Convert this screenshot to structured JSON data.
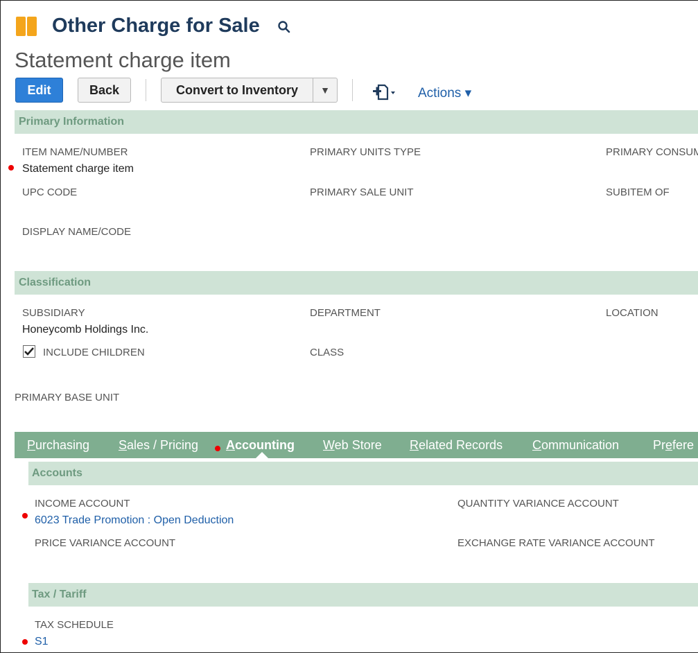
{
  "header": {
    "record_type": "Other Charge for Sale",
    "record_title": "Statement charge item"
  },
  "toolbar": {
    "edit_label": "Edit",
    "back_label": "Back",
    "convert_label": "Convert to Inventory",
    "convert_caret": "▼",
    "actions_label": "Actions ▾"
  },
  "primary_info": {
    "section_title": "Primary Information",
    "item_name_label": "ITEM NAME/NUMBER",
    "item_name_value": "Statement charge item",
    "primary_units_type_label": "PRIMARY UNITS TYPE",
    "primary_consum_label": "PRIMARY CONSUM",
    "upc_code_label": "UPC CODE",
    "primary_sale_unit_label": "PRIMARY SALE UNIT",
    "subitem_of_label": "SUBITEM OF",
    "display_name_label": "DISPLAY NAME/CODE"
  },
  "classification": {
    "section_title": "Classification",
    "subsidiary_label": "SUBSIDIARY",
    "subsidiary_value": "Honeycomb Holdings Inc.",
    "department_label": "DEPARTMENT",
    "location_label": "LOCATION",
    "include_children_label": "INCLUDE CHILDREN",
    "include_children_checked": true,
    "class_label": "CLASS",
    "primary_base_unit_label": "PRIMARY BASE UNIT"
  },
  "tabs": [
    {
      "accel": "P",
      "rest": "urchasing",
      "active": false
    },
    {
      "accel": "S",
      "rest": "ales / Pricing",
      "active": false
    },
    {
      "accel": "A",
      "rest": "ccounting",
      "active": true
    },
    {
      "accel": "W",
      "rest": "eb Store",
      "active": false
    },
    {
      "accel": "R",
      "rest": "elated Records",
      "active": false
    },
    {
      "accel": "C",
      "rest": "ommunication",
      "active": false
    },
    {
      "pre": "Pr",
      "accel": "e",
      "rest": "fere",
      "active": false
    }
  ],
  "accounts": {
    "section_title": "Accounts",
    "income_account_label": "INCOME ACCOUNT",
    "income_account_value": "6023 Trade Promotion : Open Deduction",
    "quantity_variance_label": "QUANTITY VARIANCE ACCOUNT",
    "price_variance_label": "PRICE VARIANCE ACCOUNT",
    "exchange_rate_variance_label": "EXCHANGE RATE VARIANCE ACCOUNT"
  },
  "tax": {
    "section_title": "Tax / Tariff",
    "tax_schedule_label": "TAX SCHEDULE",
    "tax_schedule_value": "S1"
  },
  "colors": {
    "accent": "#2e80d8",
    "section_bg": "#cfe3d6",
    "tab_bar_bg": "#7fae90",
    "link": "#1f5fa8",
    "required_dot": "#ee0000"
  }
}
